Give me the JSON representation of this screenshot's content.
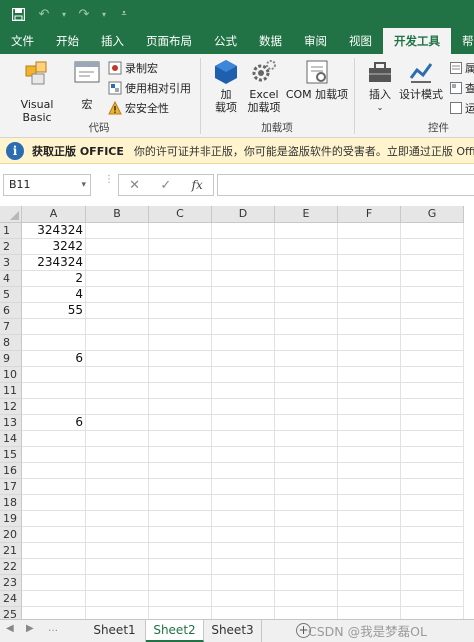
{
  "quick_access": {
    "save": "save-icon",
    "undo": "undo-icon",
    "redo": "redo-icon",
    "customize": "customize-toolbar-icon"
  },
  "tabs": [
    "文件",
    "开始",
    "插入",
    "页面布局",
    "公式",
    "数据",
    "审阅",
    "视图",
    "开发工具",
    "帮"
  ],
  "active_tab": "开发工具",
  "ribbon": {
    "code": {
      "name": "代码",
      "visual_basic": "Visual Basic",
      "macro": "宏",
      "record_macro": "录制宏",
      "relative_ref": "使用相对引用",
      "macro_security": "宏安全性"
    },
    "addins": {
      "name": "加载项",
      "addin_line1": "加",
      "addin_line2": "载项",
      "excel_line1": "Excel",
      "excel_line2": "加载项",
      "com": "COM 加载项"
    },
    "controls": {
      "name": "控件",
      "insert": "插入",
      "design_mode": "设计模式",
      "properties_partial": "属",
      "view_code_partial": "查",
      "run_dialog_partial": "运"
    }
  },
  "infobar": {
    "title": "获取正版 OFFICE",
    "message": "你的许可证并非正版，你可能是盗版软件的受害者。立即通过正版 Office 避"
  },
  "formula_bar": {
    "name_box": "B11",
    "cancel": "✕",
    "enter": "✓",
    "fx": "fx",
    "value": ""
  },
  "columns": [
    "A",
    "B",
    "C",
    "D",
    "E",
    "F",
    "G"
  ],
  "rows": [
    "1",
    "2",
    "3",
    "4",
    "5",
    "6",
    "7",
    "8",
    "9",
    "10",
    "11",
    "12",
    "13",
    "14",
    "15",
    "16",
    "17",
    "18",
    "19",
    "20",
    "21",
    "22",
    "23",
    "24",
    "25"
  ],
  "cells": [
    {
      "ref": "A1",
      "value": "324324"
    },
    {
      "ref": "A2",
      "value": "3242"
    },
    {
      "ref": "A3",
      "value": "234324"
    },
    {
      "ref": "A4",
      "value": "2"
    },
    {
      "ref": "A5",
      "value": "4"
    },
    {
      "ref": "A6",
      "value": "55"
    },
    {
      "ref": "A9",
      "value": "6"
    },
    {
      "ref": "A13",
      "value": "6"
    }
  ],
  "sheets": [
    "Sheet1",
    "Sheet2",
    "Sheet3"
  ],
  "active_sheet": "Sheet2",
  "add_sheet": "+",
  "watermark": "CSDN @我是梦磊OL"
}
